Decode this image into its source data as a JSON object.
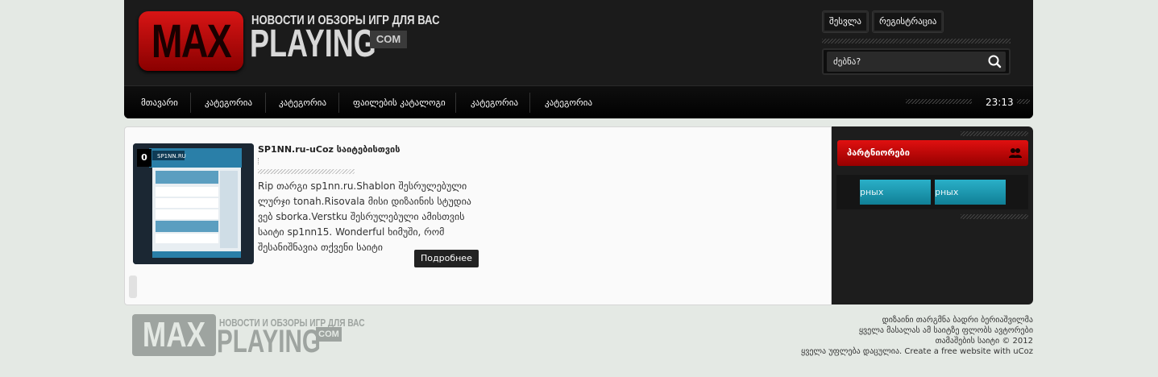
{
  "header": {
    "logo": {
      "max": "MAX",
      "playing": "PLAYING",
      "com": "COM",
      "tagline": "НОВОСТИ И ОБЗОРЫ ИГР ДЛЯ ВАС"
    },
    "login_label": "შესვლა",
    "register_label": "რეგისტრაცია",
    "search": {
      "placeholder": "ძებნა?"
    },
    "nav": [
      "მთავარი",
      "კატეგორია",
      "კატეგორია",
      "ფაილების კატალოგი",
      "კატეგორია",
      "კატეგორია"
    ],
    "time": "23:13"
  },
  "post": {
    "count": "0",
    "title": "SP1NN.ru-uCoz საიტებისთვის",
    "body": "Rip თარგი sp1nn.ru.Shablon შესრულებული ლურჯი tonah.Risovala მისი დიზაინის სტუდია ვებ sborka.Verstku შესრულებული ამისთვის საიტი sp1nn15. Wonderful ხიმუში, რომ შესანიშნავია თქვენი საიტი",
    "more_label": "Подробнее",
    "thumb_site": "SP1NN.RU"
  },
  "sidebar": {
    "partners_title": "პარტნიორები",
    "partner_buttons": [
      "рных",
      "рных"
    ]
  },
  "footer": {
    "logo": {
      "max": "MAX",
      "playing": "PLAYING",
      "com": "COM",
      "tagline": "НОВОСТИ И ОБЗОРЫ ИГР ДЛЯ ВАС"
    },
    "lines": [
      "დიზაინი თარგმნა ბადრი ბერიაშვილმა",
      "ყველა მასალას ამ საიტზე ფლობს ავტორები",
      "თამაშების საიტი © 2012",
      "ყველა უფლება დაცულია. Create a free website with uCoz"
    ]
  },
  "colors": {
    "accent": "#c80000",
    "header_bg": "#1b1b1b",
    "partner_btn": "#1a98b0",
    "page_bg": "#e4e9e4"
  }
}
